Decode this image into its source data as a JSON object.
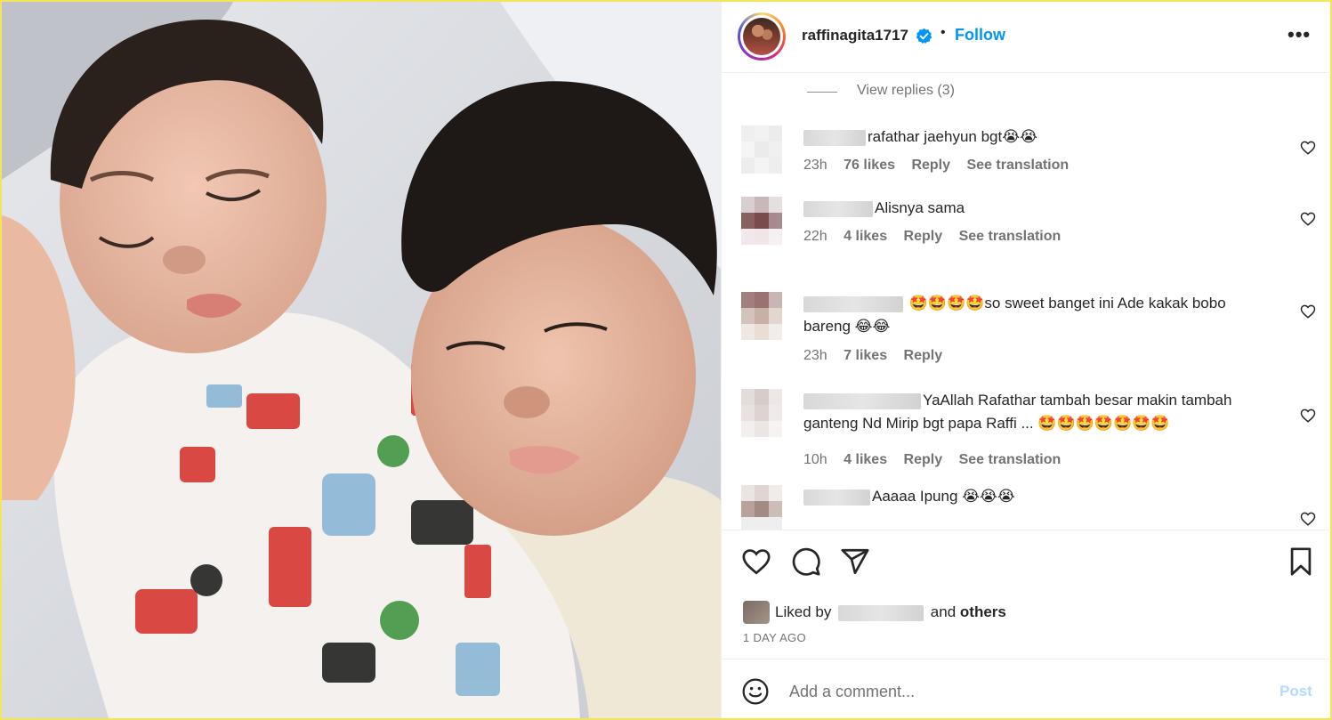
{
  "post": {
    "username": "raffinagita1717",
    "follow_label": "Follow",
    "dot": "•",
    "more_label": "•••"
  },
  "comments_section": {
    "view_replies": "View replies (3)",
    "items": [
      {
        "text": "rafathar jaehyun bgt😭😭",
        "time": "23h",
        "likes": "76 likes",
        "reply": "Reply",
        "translation": "See translation"
      },
      {
        "text": "Alisnya sama",
        "time": "22h",
        "likes": "4 likes",
        "reply": "Reply",
        "translation": "See translation"
      },
      {
        "text_line1": "🤩🤩🤩🤩so sweet banget ini Ade kakak bobo",
        "text_line2": "bareng 😂😂",
        "time": "23h",
        "likes": "7 likes",
        "reply": "Reply"
      },
      {
        "text_line1": "YaAllah Rafathar tambah besar makin tambah",
        "text_line2": "ganteng Nd Mirip bgt papa Raffi ... 🤩🤩🤩🤩🤩🤩🤩",
        "time": "10h",
        "likes": "4 likes",
        "reply": "Reply",
        "translation": "See translation"
      },
      {
        "text": "Aaaaa Ipung 😭😭😭"
      }
    ]
  },
  "footer": {
    "liked_by_prefix": "Liked by",
    "liked_by_and": "and",
    "liked_by_others": "others",
    "date": "1 DAY AGO",
    "comment_placeholder": "Add a comment...",
    "post_label": "Post"
  },
  "colors": {
    "accent": "#0095f6",
    "post_disabled": "#b3dbff",
    "muted": "#737373",
    "border": "#efefef",
    "frame": "#f3e45a"
  },
  "icons": [
    "verified-badge-icon",
    "more-options-icon",
    "heart-icon",
    "comment-icon",
    "share-icon",
    "bookmark-icon",
    "smiley-icon"
  ]
}
